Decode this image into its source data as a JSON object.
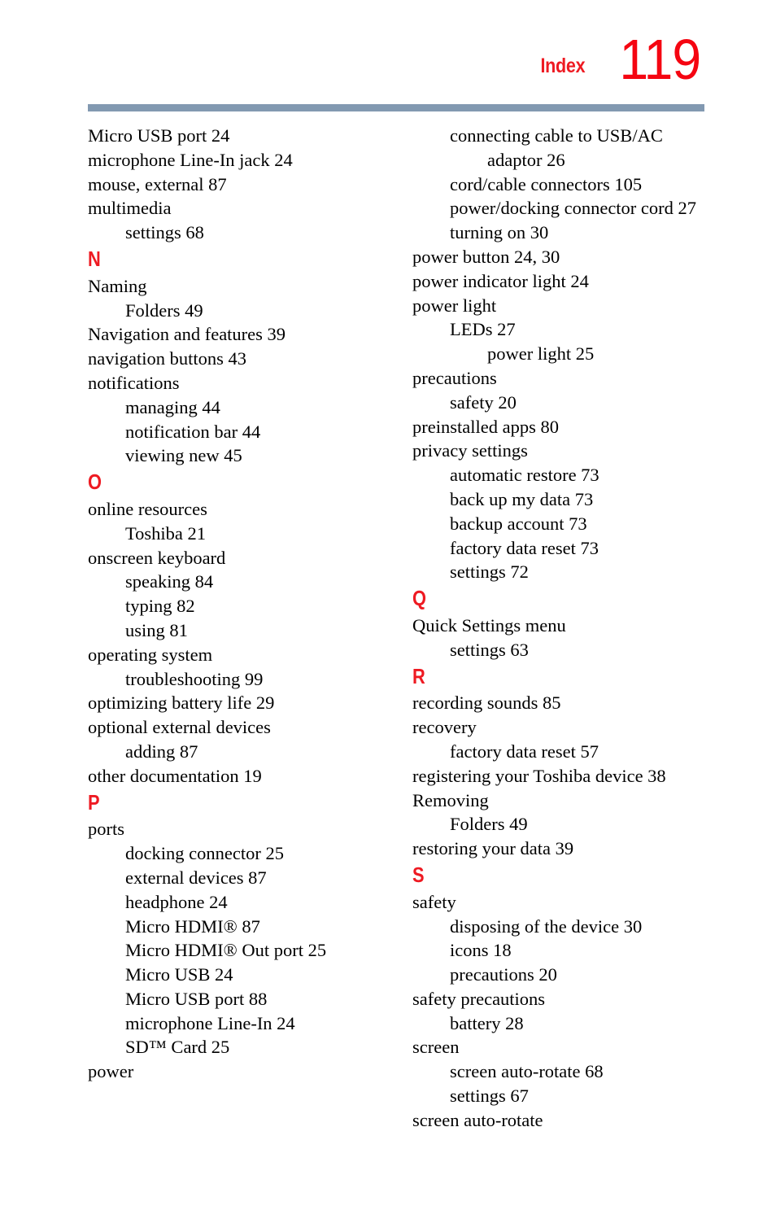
{
  "header": {
    "section_label": "Index",
    "page_number": "119",
    "accent_color": "#ee1a22",
    "page_number_color": "#f50511",
    "rule_color": "#8299b1"
  },
  "columns": [
    {
      "name": "left-column",
      "entries": [
        {
          "level": 0,
          "text": "Micro USB port 24"
        },
        {
          "level": 0,
          "text": "microphone Line-In jack 24"
        },
        {
          "level": 0,
          "text": "mouse, external 87"
        },
        {
          "level": 0,
          "text": "multimedia"
        },
        {
          "level": 1,
          "text": "settings 68"
        },
        {
          "level": -1,
          "text": "N"
        },
        {
          "level": 0,
          "text": "Naming"
        },
        {
          "level": 1,
          "text": "Folders 49"
        },
        {
          "level": 0,
          "text": "Navigation and features 39"
        },
        {
          "level": 0,
          "text": "navigation buttons 43"
        },
        {
          "level": 0,
          "text": "notifications"
        },
        {
          "level": 1,
          "text": "managing 44"
        },
        {
          "level": 1,
          "text": "notification bar 44"
        },
        {
          "level": 1,
          "text": "viewing new 45"
        },
        {
          "level": -1,
          "text": "O"
        },
        {
          "level": 0,
          "text": "online resources"
        },
        {
          "level": 1,
          "text": "Toshiba 21"
        },
        {
          "level": 0,
          "text": "onscreen keyboard"
        },
        {
          "level": 1,
          "text": "speaking 84"
        },
        {
          "level": 1,
          "text": "typing 82"
        },
        {
          "level": 1,
          "text": "using 81"
        },
        {
          "level": 0,
          "text": "operating system"
        },
        {
          "level": 1,
          "text": "troubleshooting 99"
        },
        {
          "level": 0,
          "text": "optimizing battery life 29"
        },
        {
          "level": 0,
          "text": "optional external devices"
        },
        {
          "level": 1,
          "text": "adding 87"
        },
        {
          "level": 0,
          "text": "other documentation 19"
        },
        {
          "level": -1,
          "text": "P"
        },
        {
          "level": 0,
          "text": "ports"
        },
        {
          "level": 1,
          "text": "docking connector 25"
        },
        {
          "level": 1,
          "text": "external devices 87"
        },
        {
          "level": 1,
          "text": "headphone 24"
        },
        {
          "level": 1,
          "text": "Micro HDMI® 87"
        },
        {
          "level": 1,
          "text": "Micro HDMI® Out port 25"
        },
        {
          "level": 1,
          "text": "Micro USB 24"
        },
        {
          "level": 1,
          "text": "Micro USB port 88"
        },
        {
          "level": 1,
          "text": "microphone Line-In 24"
        },
        {
          "level": 1,
          "text": "SD™ Card 25"
        },
        {
          "level": 0,
          "text": "power"
        }
      ]
    },
    {
      "name": "right-column",
      "entries": [
        {
          "level": 1,
          "text": "connecting cable to USB/AC"
        },
        {
          "level": 2,
          "text": "adaptor 26"
        },
        {
          "level": 1,
          "text": "cord/cable connectors 105"
        },
        {
          "level": 1,
          "text": "power/docking connector cord 27"
        },
        {
          "level": 1,
          "text": "turning on 30"
        },
        {
          "level": 0,
          "text": "power button 24, 30"
        },
        {
          "level": 0,
          "text": "power indicator light 24"
        },
        {
          "level": 0,
          "text": "power light"
        },
        {
          "level": 1,
          "text": "LEDs 27"
        },
        {
          "level": 2,
          "text": "power light 25"
        },
        {
          "level": 0,
          "text": "precautions"
        },
        {
          "level": 1,
          "text": "safety 20"
        },
        {
          "level": 0,
          "text": "preinstalled apps 80"
        },
        {
          "level": 0,
          "text": "privacy settings"
        },
        {
          "level": 1,
          "text": "automatic restore 73"
        },
        {
          "level": 1,
          "text": "back up my data 73"
        },
        {
          "level": 1,
          "text": "backup account 73"
        },
        {
          "level": 1,
          "text": "factory data reset 73"
        },
        {
          "level": 1,
          "text": "settings 72"
        },
        {
          "level": -1,
          "text": "Q"
        },
        {
          "level": 0,
          "text": "Quick Settings menu"
        },
        {
          "level": 1,
          "text": "settings 63"
        },
        {
          "level": -1,
          "text": "R"
        },
        {
          "level": 0,
          "text": "recording sounds 85"
        },
        {
          "level": 0,
          "text": "recovery"
        },
        {
          "level": 1,
          "text": "factory data reset 57"
        },
        {
          "level": 0,
          "text": "registering your Toshiba device 38"
        },
        {
          "level": 0,
          "text": "Removing"
        },
        {
          "level": 1,
          "text": "Folders 49"
        },
        {
          "level": 0,
          "text": "restoring your data 39"
        },
        {
          "level": -1,
          "text": "S"
        },
        {
          "level": 0,
          "text": "safety"
        },
        {
          "level": 1,
          "text": "disposing of the device 30"
        },
        {
          "level": 1,
          "text": "icons 18"
        },
        {
          "level": 1,
          "text": "precautions 20"
        },
        {
          "level": 0,
          "text": "safety precautions"
        },
        {
          "level": 1,
          "text": "battery 28"
        },
        {
          "level": 0,
          "text": "screen"
        },
        {
          "level": 1,
          "text": "screen auto-rotate 68"
        },
        {
          "level": 1,
          "text": "settings 67"
        },
        {
          "level": 0,
          "text": "screen auto-rotate"
        }
      ]
    }
  ]
}
